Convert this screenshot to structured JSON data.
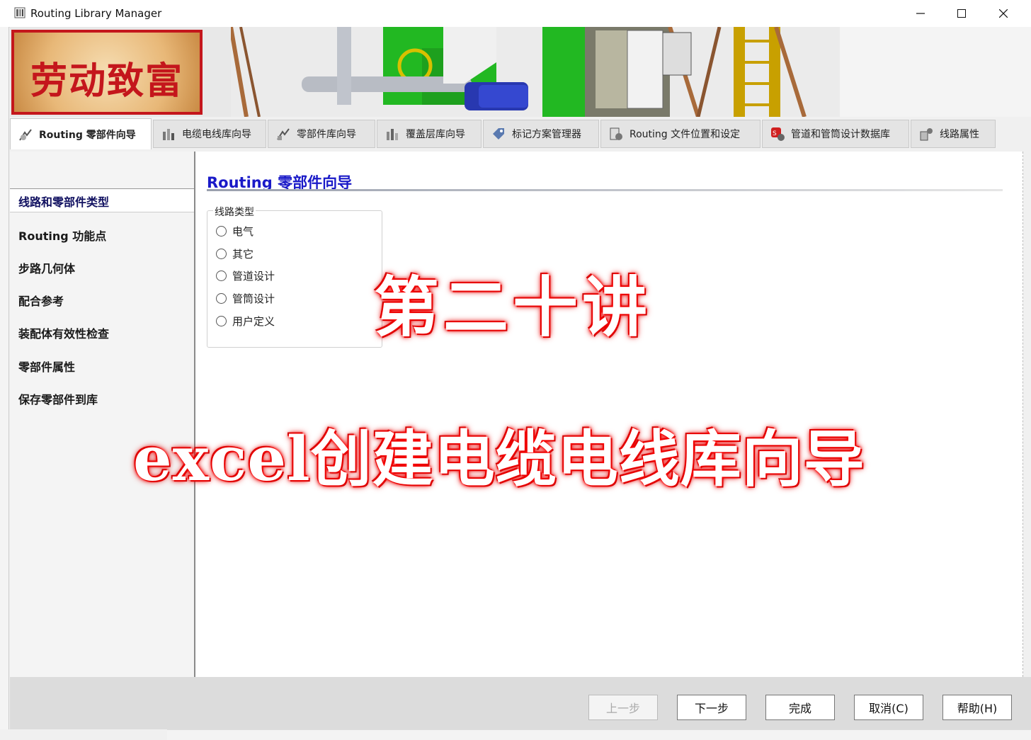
{
  "window": {
    "title": "Routing Library Manager"
  },
  "banner": {
    "logo_text": "劳动致富"
  },
  "tabs": [
    {
      "label": "Routing 零部件向导",
      "icon": "part-wizard-icon"
    },
    {
      "label": "电缆电线库向导",
      "icon": "cable-wizard-icon"
    },
    {
      "label": "零部件库向导",
      "icon": "component-library-icon"
    },
    {
      "label": "覆盖层库向导",
      "icon": "covering-library-icon"
    },
    {
      "label": "标记方案管理器",
      "icon": "tag-scheme-icon"
    },
    {
      "label": "Routing 文件位置和设定",
      "icon": "file-location-icon"
    },
    {
      "label": "管道和管筒设计数据库",
      "icon": "sw-database-icon"
    },
    {
      "label": "线路属性",
      "icon": "route-properties-icon"
    }
  ],
  "nav": {
    "items": [
      {
        "label": "线路和零部件类型"
      },
      {
        "label": "Routing 功能点"
      },
      {
        "label": "步路几何体"
      },
      {
        "label": "配合参考"
      },
      {
        "label": "装配体有效性检查"
      },
      {
        "label": "零部件属性"
      },
      {
        "label": "保存零部件到库"
      }
    ]
  },
  "main": {
    "title": "Routing 零部件向导",
    "group_label": "线路类型",
    "options": [
      "电气",
      "其它",
      "管道设计",
      "管筒设计",
      "用户定义"
    ]
  },
  "overlay": {
    "line1": "第二十讲",
    "line2": "excel创建电缆电线库向导"
  },
  "buttons": {
    "back": "上一步",
    "next": "下一步",
    "finish": "完成",
    "cancel": "取消(C)",
    "help": "帮助(H)"
  },
  "colors": {
    "title_blue": "#1a1ac8",
    "overlay_red": "#e00000",
    "logo_red": "#c4161c"
  }
}
